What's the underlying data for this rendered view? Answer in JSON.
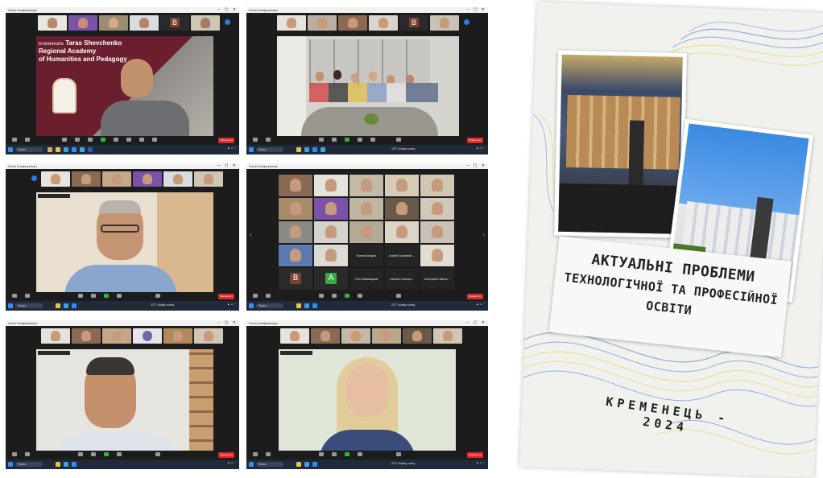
{
  "panels": [
    {
      "window_title": "Zoom Конференція",
      "slide_line1": "Taras Shevchenko",
      "slide_prefix": "Kremenets",
      "slide_line2": "Regional Academy",
      "slide_line3": "of Humanities and Pedagogy",
      "thumb_letter": "B",
      "leave_label": "Завершити",
      "search_label": "Поиск"
    },
    {
      "window_title": "Zoom Конференція",
      "thumb_letter": "B",
      "leave_label": "Завершити",
      "search_label": "Поиск",
      "weather": "19°C Mostly sunny"
    },
    {
      "window_title": "Zoom Конференція",
      "leave_label": "Завершити",
      "search_label": "Поиск",
      "weather": "21°C Mostly sunny"
    },
    {
      "window_title": "Zoom Конференція",
      "leave_label": "Завершити",
      "search_label": "Поиск",
      "weather": "21°C Mostly sunny",
      "name_tiles": [
        "Ксюха Мороз",
        "Andrej Tavardzh...",
        "Оля Карвацька",
        "Наталя Ільниц...",
        "Катерина Кияні..."
      ],
      "letter_tiles": [
        "B",
        "A"
      ]
    },
    {
      "window_title": "Zoom Конференція",
      "leave_label": "Завершити",
      "search_label": "Поиск"
    },
    {
      "window_title": "Zoom Конференція",
      "leave_label": "Завершити",
      "search_label": "Поиск",
      "weather": "21°C Mostly sunny"
    }
  ],
  "cover": {
    "title_line1": "АКТУАЛЬНІ ПРОБЛЕМИ",
    "title_line2": "ТЕХНОЛОГІЧНОЇ ТА ПРОФЕСІЙНОЇ",
    "title_line3": "ОСВІТИ",
    "footer": "КРЕМЕНЕЦЬ - 2024"
  },
  "colors": {
    "zoom_dark": "#1c1c1c",
    "leave_red": "#e02828",
    "taskbar": "#202a38",
    "flag_blue": "#2f6fd0",
    "flag_yellow": "#e8d25a",
    "academy_maroon": "#6b1f2e"
  }
}
